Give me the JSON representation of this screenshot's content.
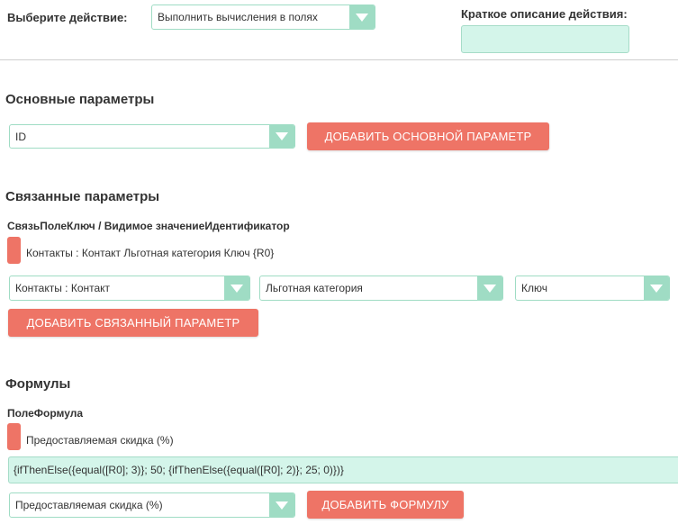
{
  "header": {
    "action_label": "Выберите действие:",
    "action_value": "Выполнить вычисления в полях",
    "description_label": "Краткое описание действия:",
    "description_value": ""
  },
  "main_params": {
    "title": "Основные параметры",
    "select_value": "ID",
    "add_button": "ДОБАВИТЬ ОСНОВНОЙ ПАРАМЕТР"
  },
  "related_params": {
    "title": "Связанные параметры",
    "columns_header": "СвязьПолеКлюч / Видимое значениеИдентификатор",
    "rows": [
      {
        "text": "Контакты : Контакт Льготная категория Ключ {R0}"
      }
    ],
    "select_link": "Контакты : Контакт",
    "select_field": "Льготная категория",
    "select_key": "Ключ",
    "add_button": "ДОБАВИТЬ СВЯЗАННЫЙ ПАРАМЕТР"
  },
  "formulas": {
    "title": "Формулы",
    "columns_header": "ПолеФормула",
    "rows": [
      {
        "text": "Предоставляемая скидка (%)"
      }
    ],
    "formula_value": "{ifThenElse({equal([R0]; 3)}; 50; {ifThenElse({equal([R0]; 2)}; 25; 0)})}",
    "select_field": "Предоставляемая скидка (%)",
    "add_button": "ДОБАВИТЬ ФОРМУЛУ"
  },
  "colors": {
    "accent_mint": "#9fdcc4",
    "input_mint": "#d4f5ea",
    "button_salmon": "#ee7466"
  },
  "icons": {
    "dropdown": "chevron-down-icon",
    "delete": "delete-pill-icon"
  }
}
